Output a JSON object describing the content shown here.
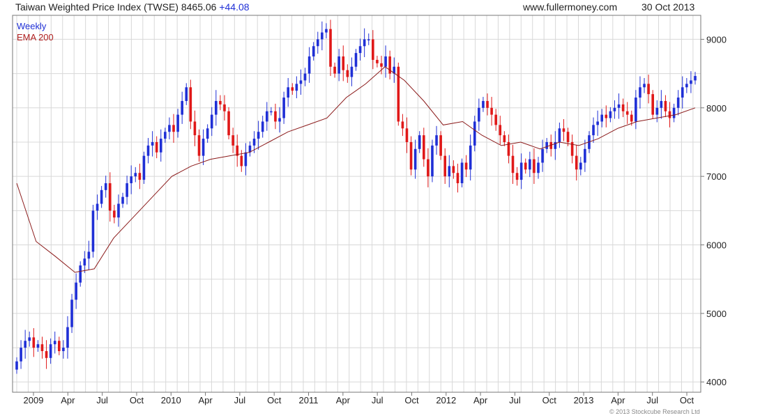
{
  "header": {
    "title": "Taiwan Weighted Price Index (TWSE) 8465.06",
    "change": "+44.08",
    "site": "www.fullermoney.com",
    "date": "30 Oct 2013"
  },
  "legend": {
    "series1": "Weekly",
    "series2": "EMA 200"
  },
  "copyright": "© 2013 Stockcube Research Ltd",
  "colors": {
    "up": "#1f2fd6",
    "down": "#e01818",
    "ema": "#8b1a1a",
    "grid": "#d8d8d8",
    "frame": "#777777"
  },
  "chart_data": {
    "type": "line",
    "title": "Taiwan Weighted Price Index (TWSE)",
    "xlabel": "",
    "ylabel": "",
    "ylim": [
      3850,
      9350
    ],
    "yticks": [
      4000,
      5000,
      6000,
      7000,
      8000,
      9000
    ],
    "xticks": [
      "2009",
      "Apr",
      "Jul",
      "Oct",
      "2010",
      "Apr",
      "Jul",
      "Oct",
      "2011",
      "Apr",
      "Jul",
      "Oct",
      "2012",
      "Apr",
      "Jul",
      "Oct",
      "2013",
      "Apr",
      "Jul",
      "Oct"
    ],
    "grid": true,
    "legend_position": "top-left",
    "series": [
      {
        "name": "Weekly",
        "style": "candlestick",
        "values": [
          4300,
          4500,
          4600,
          4650,
          4500,
          4550,
          4450,
          4350,
          4550,
          4600,
          4450,
          4500,
          4800,
          5200,
          5450,
          5700,
          5800,
          5900,
          6500,
          6600,
          6800,
          6900,
          6500,
          6400,
          6600,
          6700,
          6900,
          7000,
          7050,
          6950,
          7300,
          7450,
          7500,
          7350,
          7550,
          7650,
          7750,
          7650,
          7900,
          8100,
          8300,
          7800,
          7600,
          7300,
          7550,
          7700,
          7900,
          8100,
          8050,
          7950,
          7600,
          7450,
          7300,
          7150,
          7350,
          7450,
          7550,
          7650,
          7800,
          7950,
          7950,
          7800,
          7850,
          8150,
          8300,
          8250,
          8350,
          8400,
          8500,
          8750,
          8900,
          9000,
          9100,
          9150,
          8600,
          8500,
          8750,
          8550,
          8450,
          8600,
          8800,
          8900,
          9000,
          9000,
          8700,
          8650,
          8600,
          8750,
          8500,
          8600,
          7800,
          7700,
          7500,
          7100,
          7400,
          7600,
          7250,
          7000,
          7450,
          7600,
          7300,
          7000,
          7150,
          7050,
          6900,
          7200,
          7100,
          7450,
          7800,
          8000,
          8100,
          8000,
          7900,
          7750,
          7600,
          7500,
          7300,
          7050,
          6950,
          7200,
          7100,
          7250,
          7050,
          7200,
          7400,
          7500,
          7400,
          7500,
          7700,
          7650,
          7500,
          7300,
          7100,
          7200,
          7400,
          7600,
          7750,
          7800,
          7900,
          7850,
          7950,
          8000,
          8050,
          7950,
          7900,
          7800,
          8150,
          8300,
          8350,
          8200,
          7900,
          8000,
          8100,
          7950,
          7850,
          8000,
          8150,
          8300,
          8350,
          8400,
          8465
        ]
      },
      {
        "name": "EMA 200",
        "style": "line",
        "values": [
          6900,
          6050,
          5830,
          5600,
          5650,
          6100,
          6400,
          6700,
          7000,
          7150,
          7250,
          7300,
          7350,
          7500,
          7650,
          7750,
          7850,
          8150,
          8350,
          8600,
          8400,
          8100,
          7750,
          7800,
          7600,
          7450,
          7500,
          7400,
          7500,
          7450,
          7550,
          7700,
          7800,
          7850,
          7900,
          8000
        ]
      }
    ]
  }
}
